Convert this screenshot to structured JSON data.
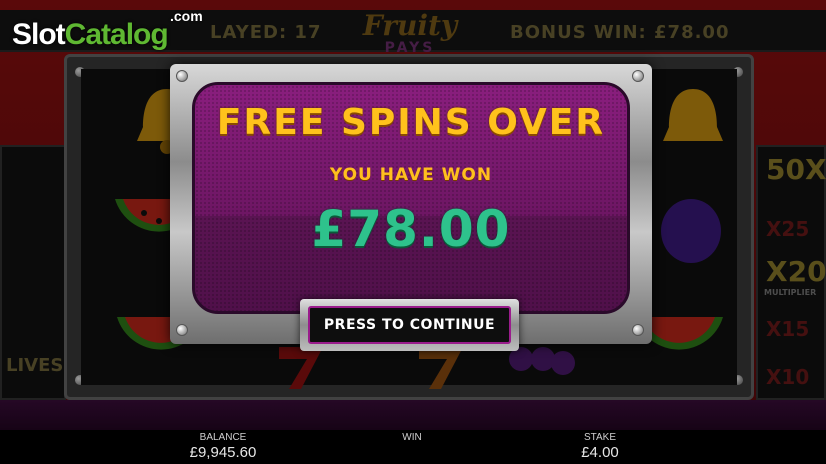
{
  "watermark": {
    "brand_part1": "Slot",
    "brand_part2": "Catalog",
    "suffix": ".com"
  },
  "game_header": {
    "played_text": "LAYED: 17",
    "bonus_win_text": "BONUS WIN: £78.00",
    "logo_line1": "Fruity",
    "logo_line2": "PAYS"
  },
  "side_panels": {
    "left_label": "LIVES",
    "multipliers": [
      "50X",
      "X25",
      "X20",
      "X15",
      "X10"
    ],
    "multiplier_caption": "MULTIPLIER"
  },
  "popup": {
    "headline": "FREE SPINS OVER",
    "subline": "YOU HAVE WON",
    "amount": "£78.00",
    "button_label": "PRESS TO CONTINUE"
  },
  "bottom_bar": {
    "balance_label": "BALANCE",
    "balance_value": "£9,945.60",
    "win_label": "WIN",
    "win_value": "",
    "stake_label": "STAKE",
    "stake_value": "£4.00"
  },
  "colors": {
    "headline_gold": "#ffc21c",
    "amount_green": "#2ec28c",
    "screen_purple": "#7a1a70",
    "brand_green": "#5fb832"
  },
  "icons": [
    "bell-icon",
    "watermelon-icon",
    "plum-icon",
    "grapes-icon",
    "seven-icon"
  ]
}
